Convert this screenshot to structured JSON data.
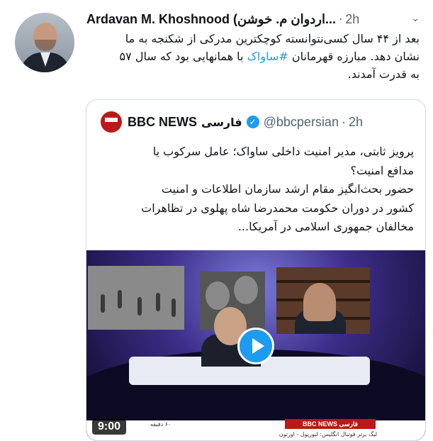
{
  "tweet": {
    "author": "Ardavan M. Khoshnood (اردوان م. خوشن...",
    "time": "2h",
    "text_line1": "بعد از ۴۴ سال کسی‌نتوانسته کوچکترین مدرکی از شکنجه به ما",
    "text_line2_before": "نشان دهد. مبارزه قهرمانان ",
    "hashtag": "#ساواک",
    "text_line2_after": " با همانهایی بود که سال ۵۷",
    "text_line3": "به قدرت آمدند."
  },
  "quote": {
    "name": "BBC NEWS",
    "name_persian": "فارسی",
    "handle": "@bbcpersian",
    "time": "2h",
    "text_line1": "پرویز ثابتی، مدیر امنیت داخلی ساواک؛ عامل سرکوب یا",
    "text_line2": "مدافع امنیت؟",
    "text_line3": "حضور بحث‌انگیز مقام ارشد سازمان اطلاعات و امنیت",
    "text_line4": "کشور در دوران حکومت محمدرضا شاه پهلوی در تظاهرات",
    "text_line5": "مخالفان جمهوری اسلامی در آمریکا..."
  },
  "media": {
    "duration": "9:00",
    "ticker_brand": "BBC NEWS فارسی",
    "ticker_time": "۶۰ دقیقه",
    "ticker_bottom": "لیگ برتر فوتبال انگلیس: لیورپول - اورتون"
  },
  "colors": {
    "link": "#1d9bf0",
    "brand_red": "#bb1919",
    "muted": "#536471"
  }
}
